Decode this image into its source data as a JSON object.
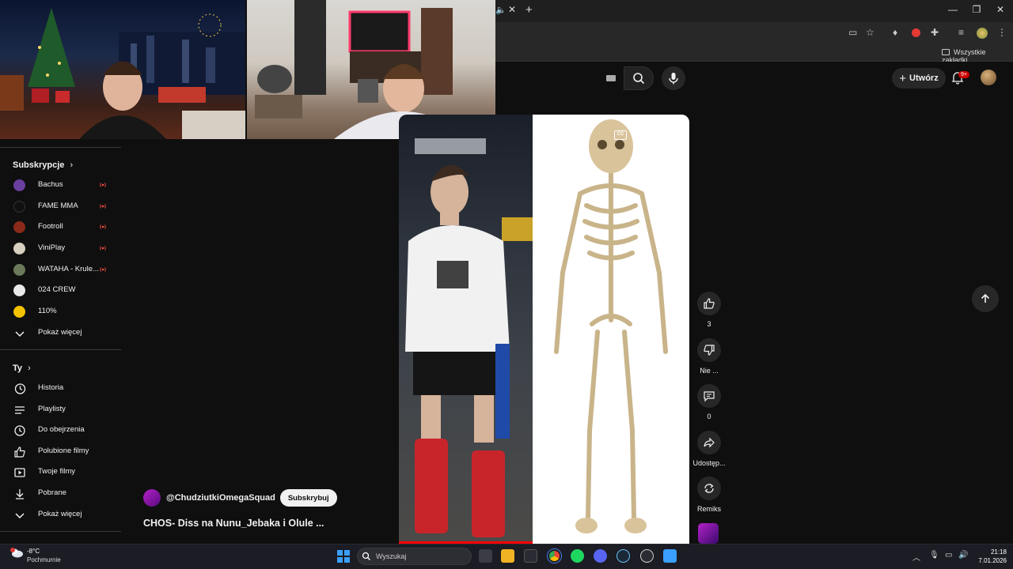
{
  "browser": {
    "bookmarks_all": "Wszystkie zakładki",
    "bell_badge": "9+"
  },
  "youtube": {
    "create_label": "Utwórz"
  },
  "sidebar": {
    "subscriptions_heading": "Subskrypcje",
    "subscriptions": [
      {
        "label": "Bachus",
        "live": true,
        "avatar_color": "#6b3fa0"
      },
      {
        "label": "FAME MMA",
        "live": true,
        "avatar_color": "#111111"
      },
      {
        "label": "Footroll",
        "live": true,
        "avatar_color": "#8b2a1a"
      },
      {
        "label": "ViniPlay",
        "live": true,
        "avatar_color": "#d8d0c0"
      },
      {
        "label": "WATAHA - Krule...",
        "live": true,
        "avatar_color": "#6a7a5a"
      },
      {
        "label": "024 CREW",
        "live": false,
        "avatar_color": "#e8e8e8"
      },
      {
        "label": "110%",
        "live": false,
        "avatar_color": "#f2c200"
      }
    ],
    "show_more_1": "Pokaż więcej",
    "you_heading": "Ty",
    "you_items": [
      {
        "label": "Historia",
        "icon": "history-icon"
      },
      {
        "label": "Playlisty",
        "icon": "playlist-icon"
      },
      {
        "label": "Do obejrzenia",
        "icon": "watch-later-icon"
      },
      {
        "label": "Polubione filmy",
        "icon": "liked-icon"
      },
      {
        "label": "Twoje filmy",
        "icon": "your-videos-icon"
      },
      {
        "label": "Pobrane",
        "icon": "download-icon"
      }
    ],
    "show_more_2": "Pokaż więcej"
  },
  "short": {
    "channel": "@ChudziutkiOmegaSquad",
    "subscribe_label": "Subskrybuj",
    "title": "CHOS- Diss na Nunu_Jebaka i Olule ...",
    "progress_fraction": 0.46,
    "cc_label": "CC"
  },
  "actions": {
    "like_count": "3",
    "dislike_label": "Nie ...",
    "comments_count": "0",
    "share_label": "Udostęp...",
    "remix_label": "Remiks"
  },
  "taskbar": {
    "temperature": "-8°C",
    "weather": "Pochmurnie",
    "search_placeholder": "Wyszukaj",
    "time": "21:18",
    "date": "7.01.2026"
  },
  "colors": {
    "accent_red": "#ff0000",
    "background": "#0f0f0f"
  }
}
